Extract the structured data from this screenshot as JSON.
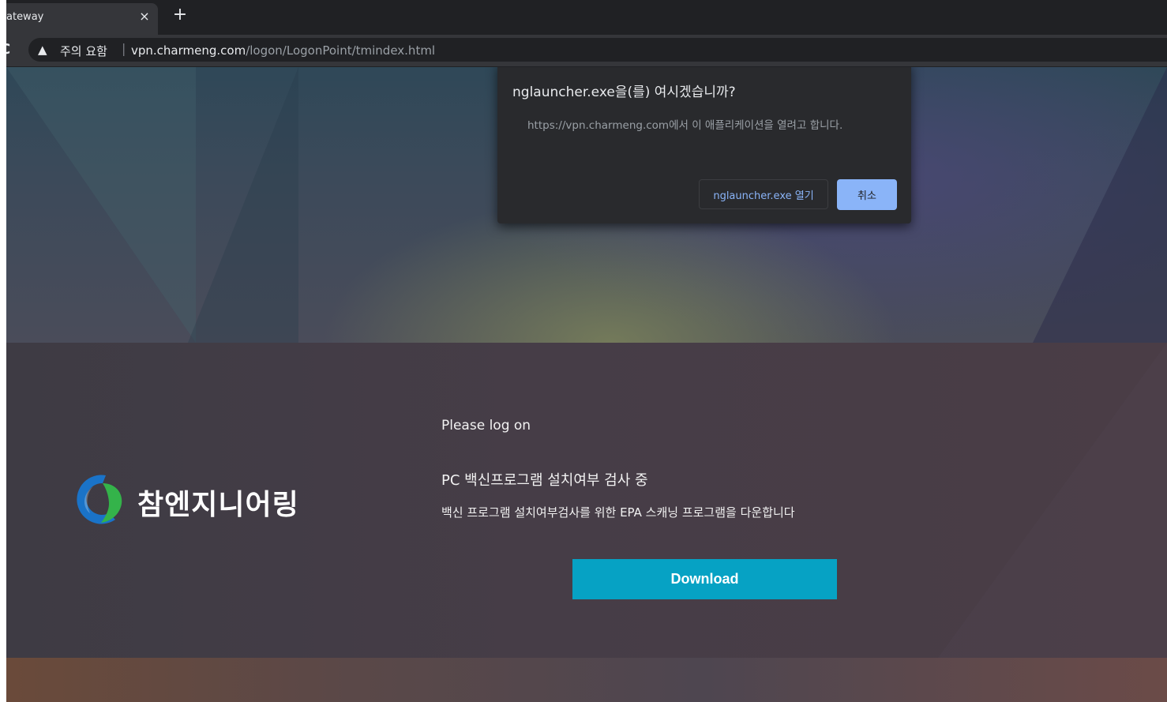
{
  "browser": {
    "tab_title": "ateway",
    "tab_close_glyph": "×",
    "new_tab_glyph": "+",
    "reload_glyph": "C",
    "security_icon": "warning-triangle-icon",
    "security_glyph": "▲",
    "security_label": "주의 요함",
    "url_separator": "|",
    "url_host": "vpn.charmeng.com",
    "url_path": "/logon/LogonPoint/tmindex.html"
  },
  "dialog": {
    "title": "nglauncher.exe을(를) 여시겠습니까?",
    "message": "https://vpn.charmeng.com에서 이 애플리케이션을 열려고 합니다.",
    "open_label": "nglauncher.exe 열기",
    "cancel_label": "취소"
  },
  "logo": {
    "text": "참엔지니어링",
    "icon": "company-logo-icon",
    "colors": {
      "blue": "#1a73c8",
      "green": "#34b34a"
    }
  },
  "login": {
    "prompt": "Please log on",
    "scan_heading": "PC 백신프로그램 설치여부 검사 중",
    "scan_description": "백신 프로그램 설치여부검사를 위한 EPA 스캐닝 프로그램을 다운합니다",
    "download_label": "Download",
    "download_color": "#06a2c4"
  }
}
